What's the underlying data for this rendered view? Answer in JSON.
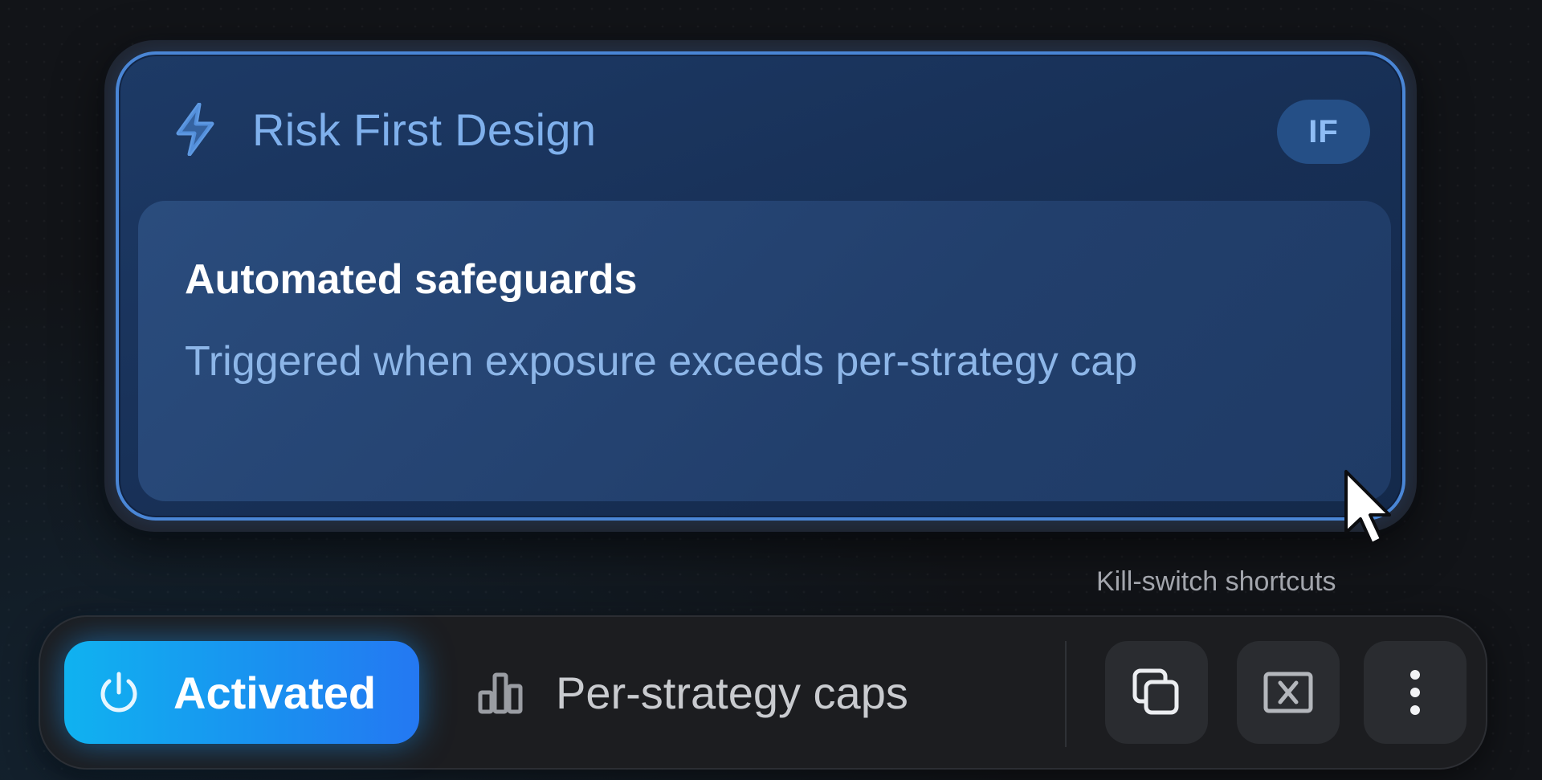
{
  "card": {
    "title": "Risk First Design",
    "badge": "IF",
    "panel": {
      "heading": "Automated safeguards",
      "description": "Triggered when exposure exceeds per-strategy cap"
    }
  },
  "hint": {
    "label": "Kill-switch shortcuts"
  },
  "toolbar": {
    "activate_label": "Activated",
    "caps_label": "Per-strategy caps",
    "icons": {
      "activate": "power-icon",
      "caps": "bar-chart-icon",
      "copy": "copy-icon",
      "close": "close-box-icon",
      "more": "more-vertical-icon"
    }
  },
  "colors": {
    "accent": "#1a8ff0",
    "card_border": "#4a86d6",
    "title_blue": "#7fb0ec",
    "background": "#121418"
  }
}
